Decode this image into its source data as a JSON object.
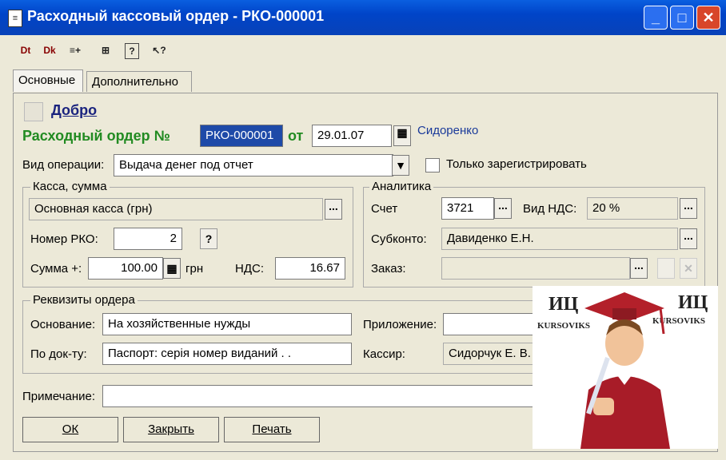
{
  "window": {
    "title": "Расходный кассовый ордер - РКО-000001",
    "doc_icon": "document-icon",
    "min": "_",
    "max": "□",
    "close": "✕"
  },
  "toolbar": {
    "icons": [
      "Dt",
      "Dk",
      "≡+",
      "⊞",
      "?",
      "↖?"
    ]
  },
  "tabs": [
    "Основные",
    "Дополнительно"
  ],
  "header": {
    "dobro_label": "Добро",
    "order_label": "Расходный ордер №",
    "order_number": "РКО-000001",
    "from_label": "от",
    "date": "29.01.07",
    "author": "Сидоренко"
  },
  "operation": {
    "label": "Вид операции:",
    "value": "Выдача денег под отчет",
    "only_register_label": "Только зарегистрировать"
  },
  "kassa": {
    "group_label": "Касса, сумма",
    "kassa_value": "Основная касса (грн)",
    "rko_number_label": "Номер РКО:",
    "rko_number": "2",
    "sum_label": "Сумма +:",
    "sum_value": "100.00",
    "currency": "грн",
    "nds_label": "НДС:",
    "nds_value": "16.67"
  },
  "analytics": {
    "group_label": "Аналитика",
    "account_label": "Счет",
    "account_value": "3721",
    "vat_type_label": "Вид НДС:",
    "vat_type_value": "20 %",
    "subconto_label": "Субконто:",
    "subconto_value": "Давиденко Е.Н.",
    "order_label": "Заказ:",
    "order_value": ""
  },
  "requisites": {
    "group_label": "Реквизиты ордера",
    "basis_label": "Основание:",
    "basis_value": "На хозяйственные нужды",
    "attachment_label": "Приложение:",
    "attachment_value": "",
    "by_doc_label": "По док-ту:",
    "by_doc_value": "Паспорт: серія  номер  виданий  .  .",
    "cashier_label": "Кассир:",
    "cashier_value": "Сидорчук Е. В."
  },
  "note": {
    "label": "Примечание:",
    "value": ""
  },
  "buttons": {
    "ok": "ОК",
    "close": "Закрыть",
    "print": "Печать"
  },
  "watermark": {
    "logo_left": "ИЦ",
    "logo_right": "ИЦ",
    "brand_left": "KURSOVIKS",
    "brand_right": "KURSOVIKS"
  }
}
